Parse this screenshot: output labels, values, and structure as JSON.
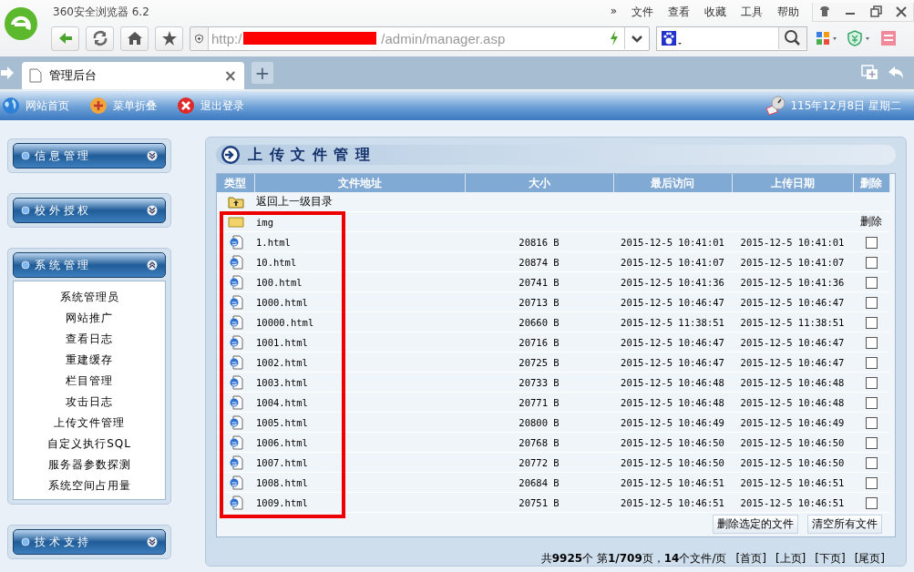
{
  "browser": {
    "title": "360安全浏览器 6.2",
    "menu": [
      "»",
      "文件",
      "查看",
      "收藏",
      "工具",
      "帮助"
    ],
    "url_prefix": "http:/",
    "url_suffix": "/admin/manager.asp",
    "redacted": true,
    "tab": {
      "title": "管理后台",
      "close": "×",
      "selected": true
    },
    "new_tab": "+"
  },
  "toolbar": {
    "links": [
      {
        "kind": "home",
        "label": "网站首页"
      },
      {
        "kind": "collapse",
        "label": "菜单折叠"
      },
      {
        "kind": "logout",
        "label": "退出登录"
      }
    ],
    "date": "115年12月8日  星期二"
  },
  "sidebar": {
    "groups": [
      {
        "title": "信 息 管 理",
        "expanded": false
      },
      {
        "title": "校 外 授 权",
        "expanded": false
      },
      {
        "title": "系 统 管 理",
        "expanded": true,
        "items": [
          "系统管理员",
          "网站推广",
          "查看日志",
          "重建缓存",
          "栏目管理",
          "攻击日志",
          "上传文件管理",
          "自定义执行SQL",
          "服务器参数探测",
          "系统空间占用量"
        ]
      },
      {
        "title": "技 术 支 持",
        "expanded": false
      }
    ]
  },
  "panel": {
    "title": "上 传 文 件 管 理",
    "highlight": true,
    "table": {
      "columns": [
        "类型",
        "文件地址",
        "大小",
        "最后访问",
        "上传日期",
        "删除"
      ],
      "rows": [
        {
          "kind": "parent",
          "name": "返回上一级目录"
        },
        {
          "kind": "folder",
          "name": "img",
          "delete": "删除"
        },
        {
          "kind": "file",
          "name": "1.html",
          "size": "20816 B",
          "accessed": "2015-12-5 10:41:01",
          "uploaded": "2015-12-5 10:41:01",
          "checked": false
        },
        {
          "kind": "file",
          "name": "10.html",
          "size": "20874 B",
          "accessed": "2015-12-5 10:41:07",
          "uploaded": "2015-12-5 10:41:07",
          "checked": false
        },
        {
          "kind": "file",
          "name": "100.html",
          "size": "20741 B",
          "accessed": "2015-12-5 10:41:36",
          "uploaded": "2015-12-5 10:41:36",
          "checked": false
        },
        {
          "kind": "file",
          "name": "1000.html",
          "size": "20713 B",
          "accessed": "2015-12-5 10:46:47",
          "uploaded": "2015-12-5 10:46:47",
          "checked": false
        },
        {
          "kind": "file",
          "name": "10000.html",
          "size": "20660 B",
          "accessed": "2015-12-5 11:38:51",
          "uploaded": "2015-12-5 11:38:51",
          "checked": false
        },
        {
          "kind": "file",
          "name": "1001.html",
          "size": "20716 B",
          "accessed": "2015-12-5 10:46:47",
          "uploaded": "2015-12-5 10:46:47",
          "checked": false
        },
        {
          "kind": "file",
          "name": "1002.html",
          "size": "20725 B",
          "accessed": "2015-12-5 10:46:47",
          "uploaded": "2015-12-5 10:46:47",
          "checked": false
        },
        {
          "kind": "file",
          "name": "1003.html",
          "size": "20733 B",
          "accessed": "2015-12-5 10:46:48",
          "uploaded": "2015-12-5 10:46:48",
          "checked": false
        },
        {
          "kind": "file",
          "name": "1004.html",
          "size": "20771 B",
          "accessed": "2015-12-5 10:46:48",
          "uploaded": "2015-12-5 10:46:48",
          "checked": false
        },
        {
          "kind": "file",
          "name": "1005.html",
          "size": "20800 B",
          "accessed": "2015-12-5 10:46:49",
          "uploaded": "2015-12-5 10:46:49",
          "checked": false
        },
        {
          "kind": "file",
          "name": "1006.html",
          "size": "20768 B",
          "accessed": "2015-12-5 10:46:50",
          "uploaded": "2015-12-5 10:46:50",
          "checked": false
        },
        {
          "kind": "file",
          "name": "1007.html",
          "size": "20772 B",
          "accessed": "2015-12-5 10:46:50",
          "uploaded": "2015-12-5 10:46:50",
          "checked": false
        },
        {
          "kind": "file",
          "name": "1008.html",
          "size": "20684 B",
          "accessed": "2015-12-5 10:46:51",
          "uploaded": "2015-12-5 10:46:51",
          "checked": false
        },
        {
          "kind": "file",
          "name": "1009.html",
          "size": "20751 B",
          "accessed": "2015-12-5 10:46:51",
          "uploaded": "2015-12-5 10:46:51",
          "checked": false
        }
      ]
    },
    "buttons": [
      "删除选定的文件",
      "清空所有文件"
    ],
    "pagination": {
      "summary": "共**9925**个  第**1/709**页，**14**个文件/页",
      "links": [
        "[首页]",
        "[上页]",
        "[下页]",
        "[尾页]"
      ]
    }
  }
}
